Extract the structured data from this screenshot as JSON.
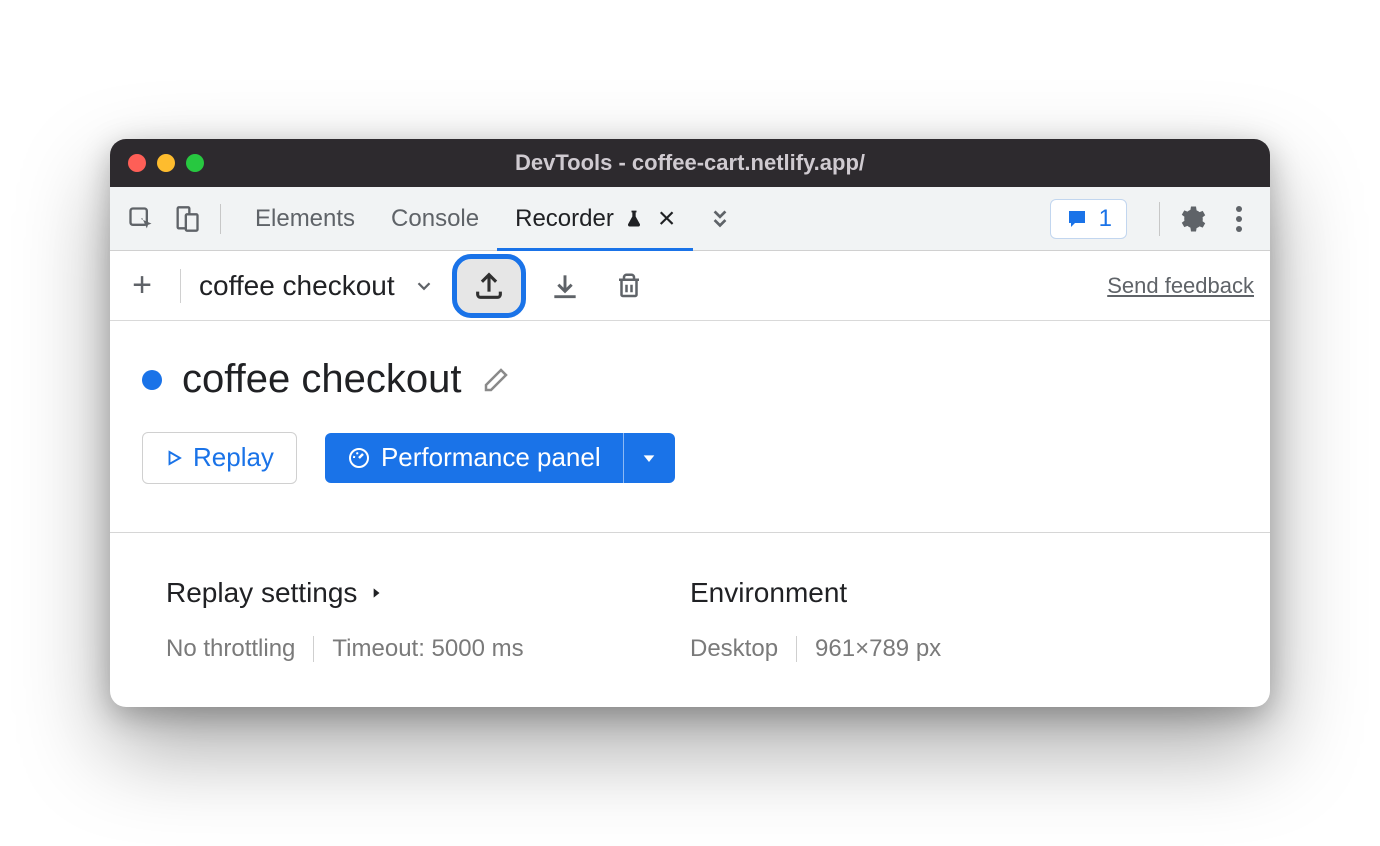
{
  "window": {
    "title": "DevTools - coffee-cart.netlify.app/"
  },
  "tabs": {
    "elements": "Elements",
    "console": "Console",
    "recorder": "Recorder"
  },
  "issues": {
    "count": "1"
  },
  "toolbar": {
    "recording_name": "coffee checkout",
    "feedback": "Send feedback"
  },
  "main": {
    "title": "coffee checkout",
    "replay_label": "Replay",
    "performance_label": "Performance panel"
  },
  "settings": {
    "heading": "Replay settings",
    "throttling": "No throttling",
    "timeout": "Timeout: 5000 ms"
  },
  "environment": {
    "heading": "Environment",
    "device": "Desktop",
    "viewport": "961×789 px"
  }
}
